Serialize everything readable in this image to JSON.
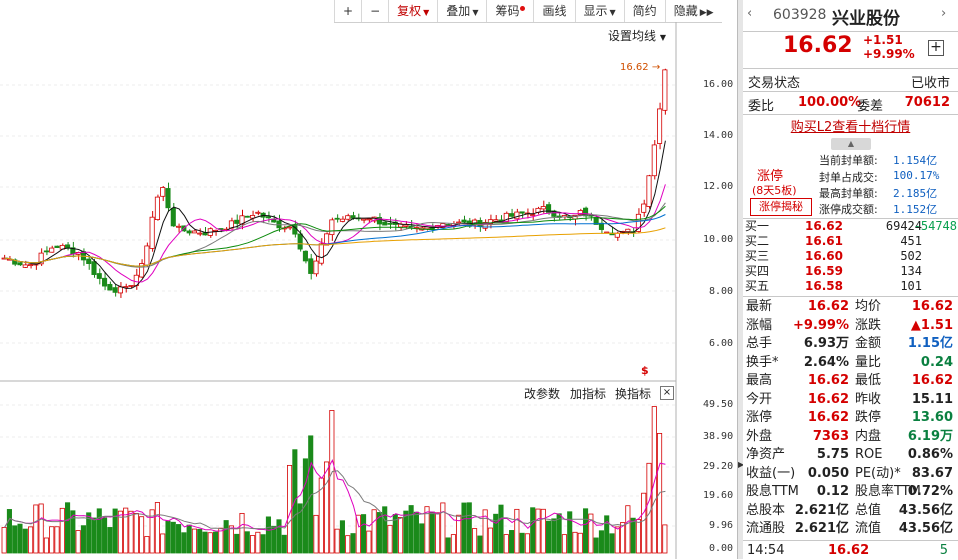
{
  "toolbar": {
    "zoom_in": "+",
    "zoom_out": "−",
    "fuquan": "复权",
    "diejia": "叠加",
    "chouma": "筹码",
    "huaxian": "画线",
    "xianshi": "显示",
    "jianyue": "简约",
    "yincang": "隐藏",
    "expand": "▶▶"
  },
  "chart": {
    "ma_setting": "设置均线",
    "price_tag": "16.62",
    "price_axis": [
      "16.00",
      "14.00",
      "12.00",
      "10.00",
      "8.00",
      "6.00"
    ],
    "vol_axis": [
      "49.50",
      "38.90",
      "29.20",
      "19.60",
      "9.96",
      "0.00"
    ],
    "indicator_buttons": {
      "change_param": "改参数",
      "add_ind": "加指标",
      "switch_ind": "换指标"
    },
    "close_ind": "×",
    "marker_s": "$",
    "colors": {
      "up": "#d40000",
      "down": "#1a8a1a",
      "ma5": "#111111",
      "ma10": "#e000c0",
      "ma20": "#7a7a7a",
      "ma30": "#0a8a0a",
      "ma60": "#0070d0",
      "ma120": "#e8a000"
    }
  },
  "panel": {
    "nav_prev": "‹",
    "nav_next": "›",
    "code": "603928",
    "name": "兴业股份",
    "price": "16.62",
    "change": "+1.51",
    "change_pct": "+9.99%",
    "add": "+",
    "status_label": "交易状态",
    "status_value": "已收市",
    "weibi_label": "委比",
    "weibi_value": "100.00%",
    "weicha_label": "委差",
    "weicha_value": "70612",
    "l2_link": "购买L2查看十档行情",
    "seal": {
      "zt_title": "涨停",
      "zt_board": "(8天5板)",
      "zt_button": "涨停揭秘",
      "rows": [
        {
          "label": "当前封单额:",
          "value": "1.154亿"
        },
        {
          "label": "封单占成交:",
          "value": "100.17%"
        },
        {
          "label": "最高封单额:",
          "value": "2.185亿"
        },
        {
          "label": "涨停成交额:",
          "value": "1.152亿"
        }
      ]
    },
    "bids": [
      {
        "label": "买一",
        "price": "16.62",
        "vol": "69424",
        "extra": "-54748"
      },
      {
        "label": "买二",
        "price": "16.61",
        "vol": "451",
        "extra": ""
      },
      {
        "label": "买三",
        "price": "16.60",
        "vol": "502",
        "extra": ""
      },
      {
        "label": "买四",
        "price": "16.59",
        "vol": "134",
        "extra": ""
      },
      {
        "label": "买五",
        "price": "16.58",
        "vol": "101",
        "extra": ""
      }
    ],
    "quotes_left": [
      {
        "label": "最新",
        "value": "16.62",
        "color": "#d40000"
      },
      {
        "label": "涨幅",
        "value": "+9.99%",
        "color": "#d40000"
      },
      {
        "label": "总手",
        "value": "6.93万",
        "color": "#222222"
      },
      {
        "label": "换手*",
        "value": "2.64%",
        "color": "#222222"
      },
      {
        "label": "最高",
        "value": "16.62",
        "color": "#d40000"
      },
      {
        "label": "今开",
        "value": "16.62",
        "color": "#d40000"
      },
      {
        "label": "涨停",
        "value": "16.62",
        "color": "#d40000"
      },
      {
        "label": "外盘",
        "value": "7363",
        "color": "#d40000"
      },
      {
        "label": "净资产",
        "value": "5.75",
        "color": "#222222"
      },
      {
        "label": "收益(一)",
        "value": "0.050",
        "color": "#222222"
      },
      {
        "label": "股息TTM",
        "value": "0.12",
        "color": "#222222"
      },
      {
        "label": "总股本",
        "value": "2.621亿",
        "color": "#222222"
      },
      {
        "label": "流通股",
        "value": "2.621亿",
        "color": "#222222"
      }
    ],
    "quotes_right": [
      {
        "label": "均价",
        "value": "16.62",
        "color": "#d40000"
      },
      {
        "label": "涨跌",
        "value": "▲1.51",
        "color": "#d40000"
      },
      {
        "label": "金额",
        "value": "1.15亿",
        "color": "#1060c0"
      },
      {
        "label": "量比",
        "value": "0.24",
        "color": "#0a8040"
      },
      {
        "label": "最低",
        "value": "16.62",
        "color": "#d40000"
      },
      {
        "label": "昨收",
        "value": "15.11",
        "color": "#222222"
      },
      {
        "label": "跌停",
        "value": "13.60",
        "color": "#0a8040"
      },
      {
        "label": "内盘",
        "value": "6.19万",
        "color": "#0a8040"
      },
      {
        "label": "ROE",
        "value": "0.86%",
        "color": "#222222"
      },
      {
        "label": "PE(动)*",
        "value": "83.67",
        "color": "#222222"
      },
      {
        "label": "股息率TTM",
        "value": "0.72%",
        "color": "#222222"
      },
      {
        "label": "总值",
        "value": "43.56亿",
        "color": "#222222"
      },
      {
        "label": "流值",
        "value": "43.56亿",
        "color": "#222222"
      }
    ],
    "footer": {
      "time": "14:54",
      "price": "16.62",
      "vol": "5"
    }
  }
}
